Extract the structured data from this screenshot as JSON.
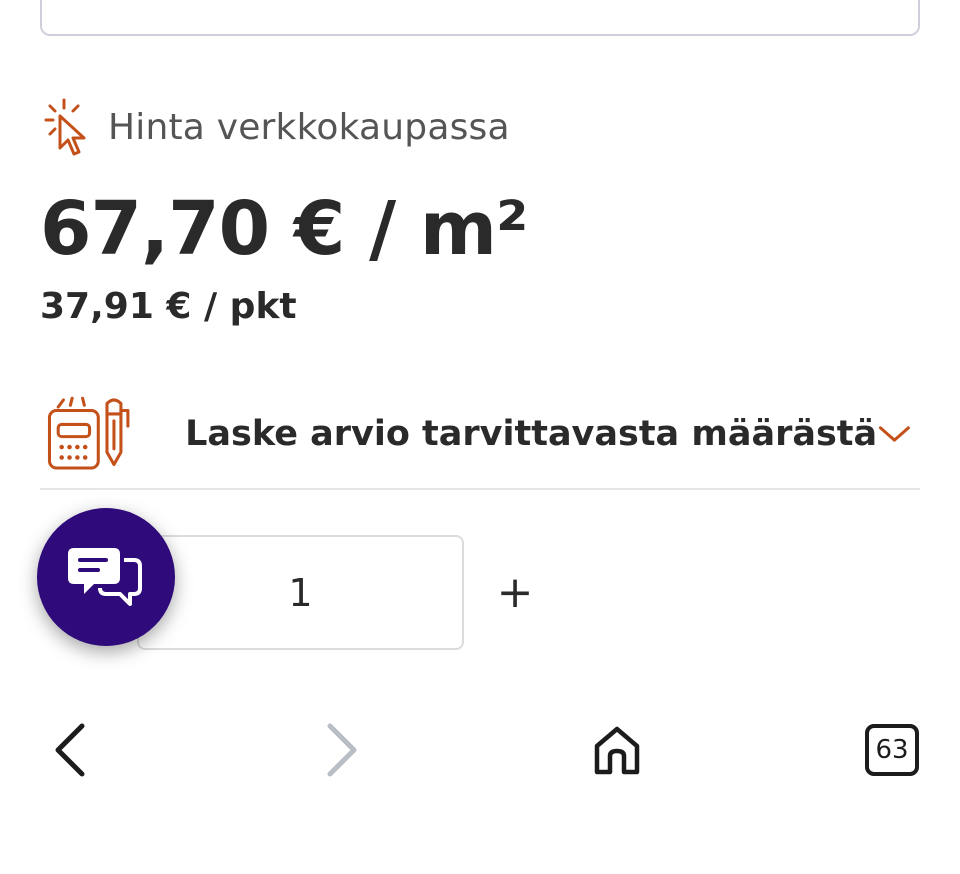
{
  "online_price": {
    "label": "Hinta verkkokaupassa",
    "icon": "click-cursor-icon"
  },
  "price": {
    "per_m2": "67,70 € / m²",
    "per_package": "37,91 € / pkt"
  },
  "calculator": {
    "label": "Laske arvio tarvittavasta määrästä",
    "icon": "calculator-pen-icon",
    "expand_icon": "chevron-down-icon"
  },
  "quantity": {
    "value": "1",
    "increase_label": "+"
  },
  "chat": {
    "icon": "chat-bubbles-icon"
  },
  "browser_nav": {
    "back_icon": "chevron-left-icon",
    "forward_icon": "chevron-right-icon",
    "home_icon": "home-icon",
    "tabs_count": "63"
  },
  "colors": {
    "accent_orange": "#c4501a",
    "chat_purple": "#2e0a7a",
    "text_dark": "#2a2a2a"
  }
}
